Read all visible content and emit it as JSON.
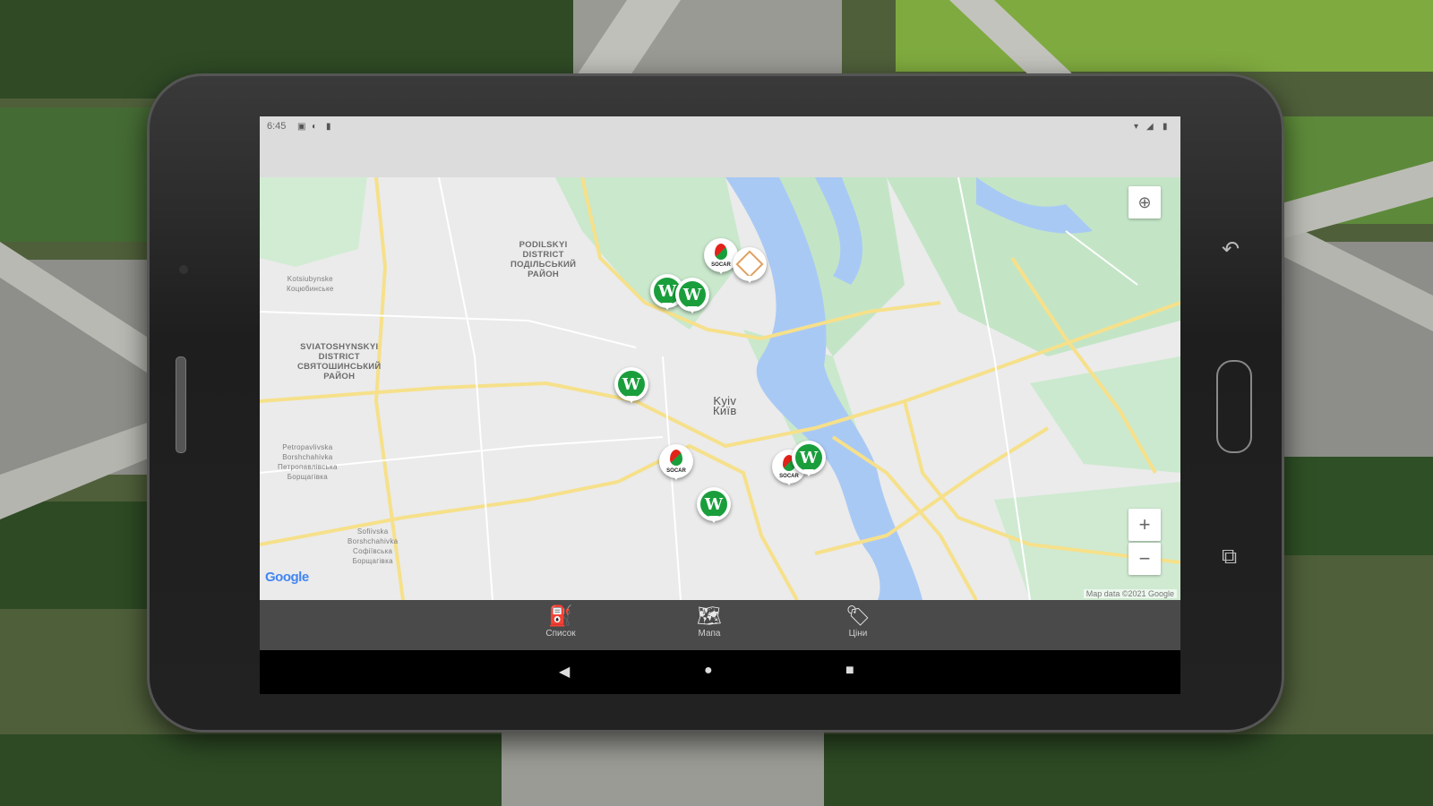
{
  "status": {
    "time": "6:45",
    "left_icons": [
      "notification-icon",
      "sync-icon",
      "battery-saver-icon"
    ],
    "right_icons": [
      "wifi-icon",
      "signal-icon",
      "battery-icon"
    ]
  },
  "map": {
    "labels": {
      "podilskyi": "PODILSKYI\nDISTRICT\nПОДІЛЬСЬКИЙ\nРАЙОН",
      "sviatoshynskyi": "SVIATOSHYNSKYI\nDISTRICT\nСВЯТОШИНСЬКИЙ\nРАЙОН",
      "kotsiubynske": "Kotsiubynske\nКоцюбинське",
      "petropavlivska": "Petropavlivska\nBorshchahivka\nПетропавлівська\nБорщагівка",
      "sofiivska": "Sofiivska\nBorshchahivka\nСофіївська\nБорщагівка",
      "kyiv": "Kyiv\nКиїв"
    },
    "google_logo": "Google",
    "attribution": "Map data ©2021 Google"
  },
  "markers": [
    {
      "brand": "socar",
      "label": "SOCAR"
    },
    {
      "brand": "okko",
      "label": ""
    },
    {
      "brand": "wog",
      "label": "W"
    },
    {
      "brand": "wog",
      "label": "W"
    },
    {
      "brand": "wog",
      "label": "W"
    },
    {
      "brand": "socar",
      "label": "SOCAR"
    },
    {
      "brand": "wog",
      "label": "W"
    },
    {
      "brand": "socar",
      "label": "SOCAR"
    },
    {
      "brand": "wog",
      "label": "W"
    }
  ],
  "controls": {
    "zoom_in": "+",
    "zoom_out": "−"
  },
  "bottom_nav": [
    {
      "label": "Список",
      "icon": "fuel-pump-icon"
    },
    {
      "label": "Мапа",
      "icon": "map-icon"
    },
    {
      "label": "Ціни",
      "icon": "price-tag-icon"
    }
  ],
  "colors": {
    "wog_green": "#1a9e3c",
    "socar_red": "#e2231a",
    "water": "#a9c9f5",
    "park": "#bfe6c4",
    "road": "#f6e08a"
  }
}
